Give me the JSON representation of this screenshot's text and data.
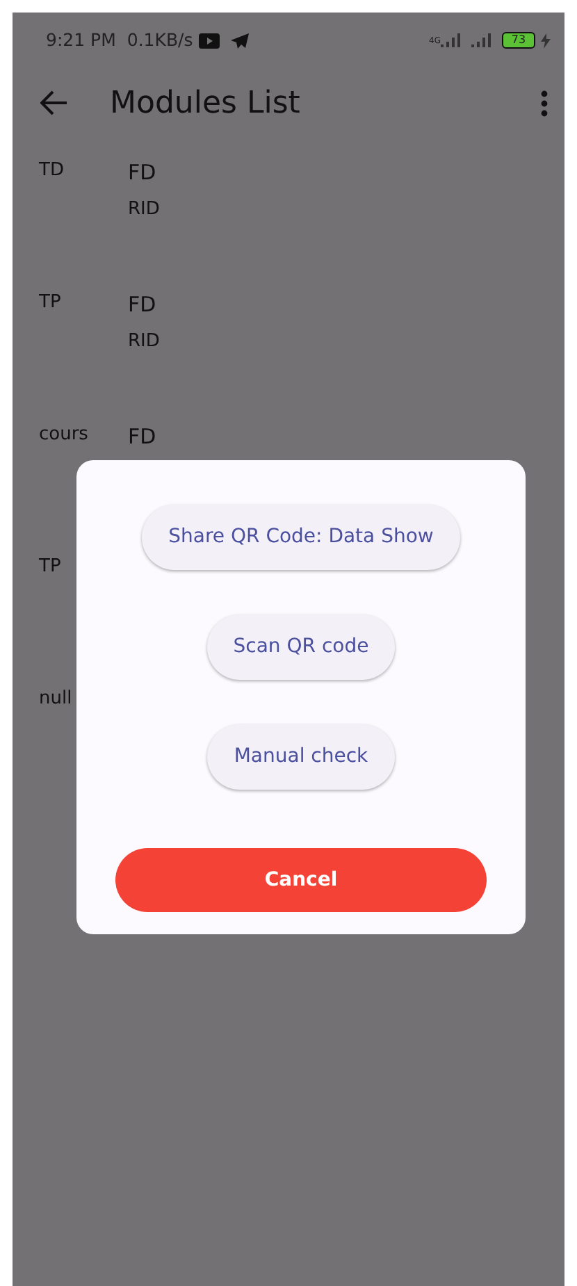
{
  "status_bar": {
    "time": "9:21 PM",
    "speed": "0.1KB/s",
    "network": "4G",
    "battery": "73"
  },
  "app_bar": {
    "title": "Modules List"
  },
  "modules": [
    {
      "type": "TD",
      "lines": [
        "FD",
        "RID"
      ]
    },
    {
      "type": "TP",
      "lines": [
        "FD",
        "RID"
      ]
    },
    {
      "type": "cours",
      "lines": [
        "FD"
      ]
    },
    {
      "type": "TP"
    },
    {
      "type": "null"
    }
  ],
  "dialog": {
    "actions": [
      {
        "label": "Share QR Code: Data Show",
        "kind": "tonal"
      },
      {
        "label": "Scan QR code",
        "kind": "tonal"
      },
      {
        "label": "Manual check",
        "kind": "tonal"
      },
      {
        "label": "Cancel",
        "kind": "danger"
      }
    ]
  }
}
